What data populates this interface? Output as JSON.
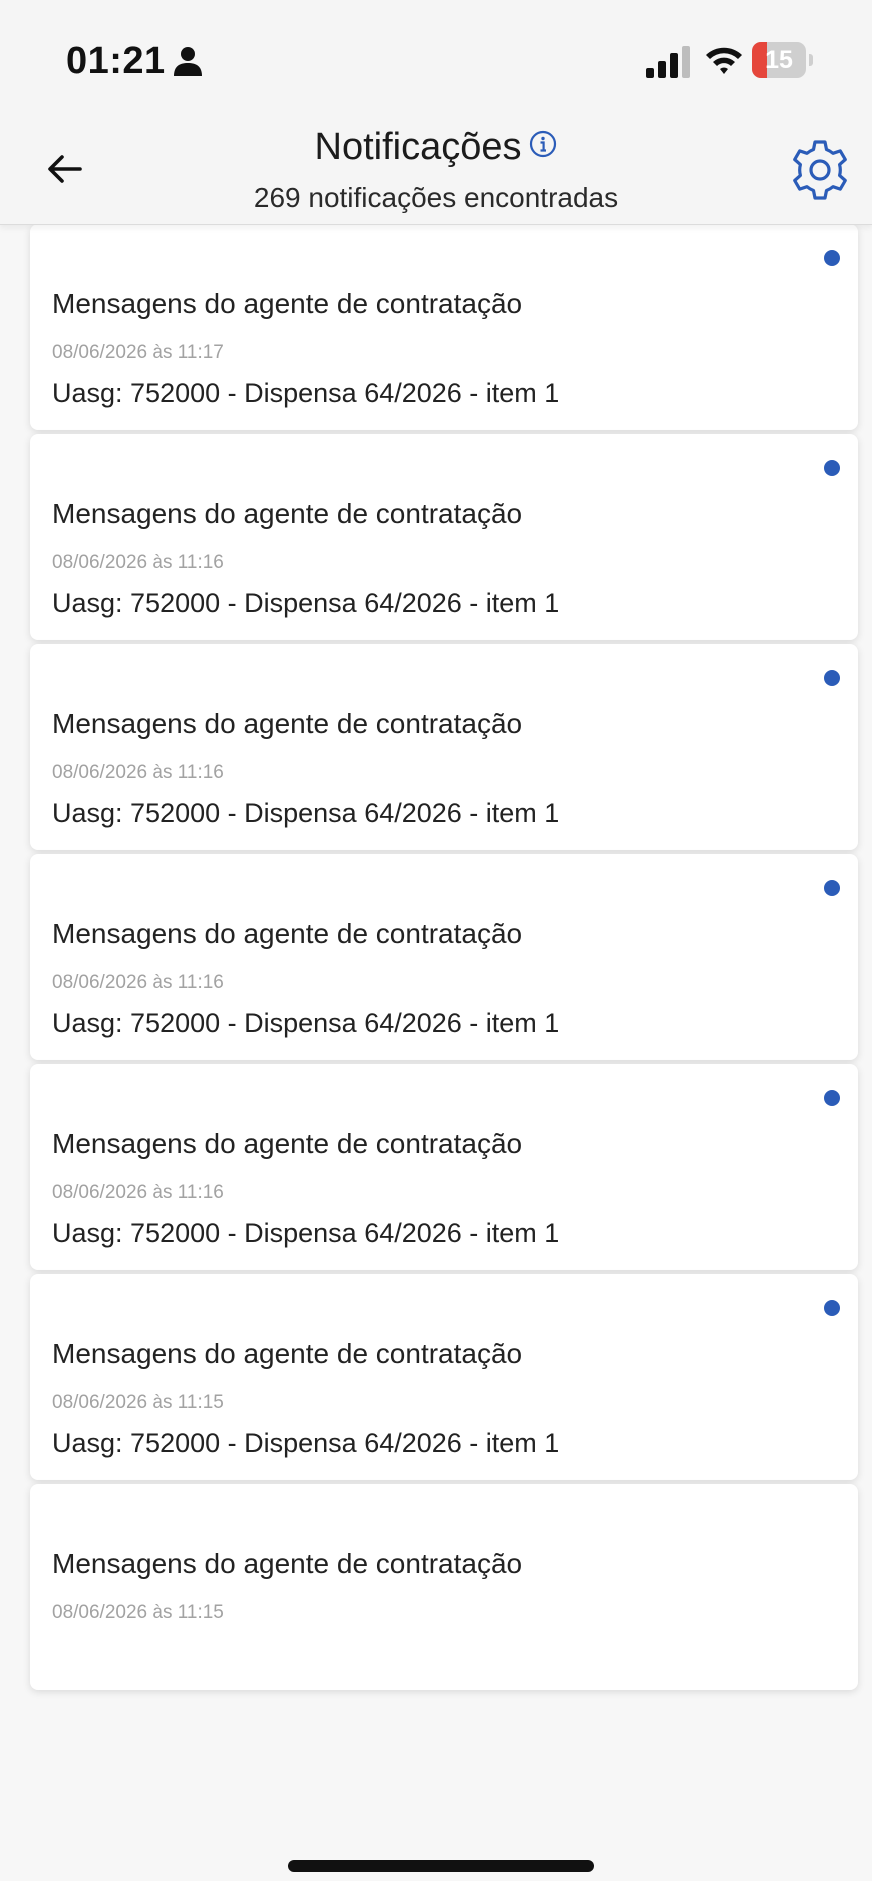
{
  "status_bar": {
    "time": "01:21",
    "battery_level": "15",
    "battery_fraction": 0.15,
    "icons": [
      "person-icon",
      "signal-icon",
      "wifi-icon",
      "battery-icon"
    ]
  },
  "header": {
    "back_icon": "arrow-left-icon",
    "title": "Notificações",
    "info_icon": "info-circle-icon",
    "subtitle": "269 notificações encontradas",
    "settings_icon": "gear-icon"
  },
  "colors": {
    "unread_dot": "#2b5cb8",
    "battery_low": "#e5463b",
    "info_icon": "#2b5cb8"
  },
  "notifications": [
    {
      "title": "Mensagens do agente de contratação",
      "date": "08/06/2026 às 11:17",
      "body": "Uasg: 752000 - Dispensa 64/2026 - item 1",
      "unread": true
    },
    {
      "title": "Mensagens do agente de contratação",
      "date": "08/06/2026 às 11:16",
      "body": "Uasg: 752000 - Dispensa 64/2026 - item 1",
      "unread": true
    },
    {
      "title": "Mensagens do agente de contratação",
      "date": "08/06/2026 às 11:16",
      "body": "Uasg: 752000 - Dispensa 64/2026 - item 1",
      "unread": true
    },
    {
      "title": "Mensagens do agente de contratação",
      "date": "08/06/2026 às 11:16",
      "body": "Uasg: 752000 - Dispensa 64/2026 - item 1",
      "unread": true
    },
    {
      "title": "Mensagens do agente de contratação",
      "date": "08/06/2026 às 11:16",
      "body": "Uasg: 752000 - Dispensa 64/2026 - item 1",
      "unread": true
    },
    {
      "title": "Mensagens do agente de contratação",
      "date": "08/06/2026 às 11:15",
      "body": "Uasg: 752000 - Dispensa 64/2026 - item 1",
      "unread": true
    },
    {
      "title": "Mensagens do agente de contratação",
      "date": "08/06/2026 às 11:15",
      "body": "",
      "unread": false
    }
  ]
}
